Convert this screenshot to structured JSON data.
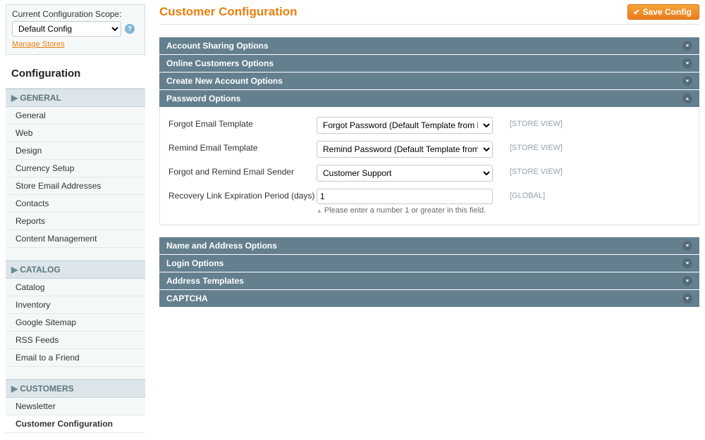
{
  "sidebar": {
    "scope_label": "Current Configuration Scope:",
    "scope_value": "Default Config",
    "manage_stores": "Manage Stores",
    "config_heading": "Configuration",
    "sections": [
      {
        "title": "GENERAL",
        "items": [
          "General",
          "Web",
          "Design",
          "Currency Setup",
          "Store Email Addresses",
          "Contacts",
          "Reports",
          "Content Management"
        ],
        "active_index": -1
      },
      {
        "title": "CATALOG",
        "items": [
          "Catalog",
          "Inventory",
          "Google Sitemap",
          "RSS Feeds",
          "Email to a Friend"
        ],
        "active_index": -1
      },
      {
        "title": "CUSTOMERS",
        "items": [
          "Newsletter",
          "Customer Configuration"
        ],
        "active_index": 1
      }
    ]
  },
  "header": {
    "title": "Customer Configuration",
    "save_button": "Save Config"
  },
  "accordion": {
    "account_sharing": "Account Sharing Options",
    "online_customers": "Online Customers Options",
    "create_account": "Create New Account Options",
    "password_options": "Password Options",
    "name_address": "Name and Address Options",
    "login_options": "Login Options",
    "address_templates": "Address Templates",
    "captcha": "CAPTCHA"
  },
  "password_form": {
    "forgot_template_label": "Forgot Email Template",
    "forgot_template_value": "Forgot Password (Default Template from Locale)",
    "remind_template_label": "Remind Email Template",
    "remind_template_value": "Remind Password (Default Template from Locale)",
    "sender_label": "Forgot and Remind Email Sender",
    "sender_value": "Customer Support",
    "recovery_label": "Recovery Link Expiration Period (days)",
    "recovery_value": "1",
    "recovery_hint": "Please enter a number 1 or greater in this field.",
    "scope_store": "[STORE VIEW]",
    "scope_global": "[GLOBAL]"
  }
}
